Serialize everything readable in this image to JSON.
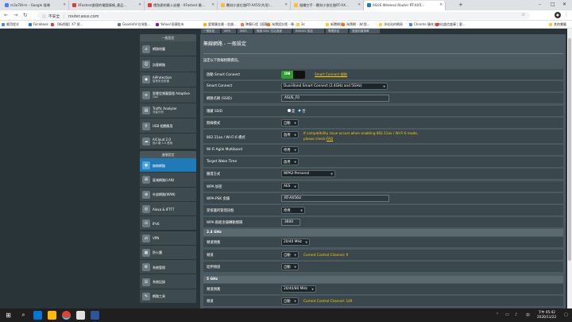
{
  "browser": {
    "tabs": [
      {
        "label": "m3a78l-m - Google 搜尋",
        "color": "#4285f4"
      },
      {
        "label": "XFastest處理的電腦情報_產品...",
        "color": "#e53935"
      },
      {
        "label": "禮急開的最入迫聲 - XFastest 最...",
        "color": "#e53935"
      },
      {
        "label": "覆刻小欲位路RT-AX55(共用)...",
        "color": "#fbc02d"
      },
      {
        "label": "縫纖空手 - 覆刻小欲位路RT-AX...",
        "color": "#fbc02d"
      },
      {
        "label": "ASUS Wireless Router RT-AX5...",
        "color": "#1f7ab8"
      }
    ],
    "new_tab": "+",
    "url": "router.asus.com",
    "security_label": "不安全",
    "window_controls": [
      "–",
      "□",
      "✕"
    ]
  },
  "bookmarks": [
    {
      "label": "應用程式",
      "color": "#4285f4"
    },
    {
      "label": "Facebook",
      "color": "#1877f2"
    },
    {
      "label": "【新遊隆】X7 搜...",
      "color": "#e53935"
    },
    {
      "label": "Goodinfo!台灣股...",
      "color": "#607d8b"
    },
    {
      "label": "Yahoo!奇摩股市",
      "color": "#7b1fa2"
    },
    {
      "label": "愛爾蘭金屬 - 金銀...",
      "color": "#ffb300"
    },
    {
      "label": "準備行程【孤龍...",
      "color": "#ff7043"
    },
    {
      "label": "淘寶設計館 - 尋...",
      "color": "#ff6d00"
    },
    {
      "label": "3c",
      "color": "#ffca28"
    },
    {
      "label": "新聞網頁",
      "color": "#ffca28"
    },
    {
      "label": "淘寶網 - 淘!我...",
      "color": "#ff6d00"
    },
    {
      "label": "淨化站的網頁",
      "color": "#ffca28"
    },
    {
      "label": "Chrome 擴充大集",
      "color": "#4285f4"
    },
    {
      "label": "松盛信盛庫 | 要...",
      "color": "#e53935"
    },
    {
      "label": "其他書籤",
      "color": "#ffca28"
    }
  ],
  "router_top_tabs": [
    "一般設定",
    "WPS",
    "WDS",
    "無線 MAC 位址過濾",
    "RADIUS 設定",
    "專業設定",
    "漫遊封鎖清單"
  ],
  "sidebar": {
    "general_header": "一般設定",
    "general_items": [
      {
        "label": "網路地圖",
        "icon": "network-map-icon",
        "glyph": "⌂"
      },
      {
        "label": "訪客網路",
        "icon": "guest-network-icon",
        "glyph": "☺"
      },
      {
        "label": "AiProtection",
        "sub": "智慧安全防護",
        "icon": "aiprotection-icon",
        "glyph": "◆"
      },
      {
        "label": "智慧型頻寬管理 Adaptive",
        "sub": "QoS",
        "icon": "qos-icon",
        "glyph": "≋"
      },
      {
        "label": "Traffic Analyzer",
        "sub": "流量分析",
        "icon": "traffic-analyzer-icon",
        "glyph": "▤"
      },
      {
        "label": "USB 相關應用",
        "icon": "usb-icon",
        "glyph": "⚲"
      },
      {
        "label": "AiCloud 2.0",
        "sub": "個人雲 2.0 應用",
        "icon": "aicloud-icon",
        "glyph": "☁"
      }
    ],
    "advanced_header": "進階設定",
    "advanced_items": [
      {
        "label": "無線網路",
        "icon": "wireless-icon",
        "glyph": "◉",
        "selected": true
      },
      {
        "label": "區域網路(LAN)",
        "icon": "lan-icon",
        "glyph": "⊞"
      },
      {
        "label": "外部網路(WAN)",
        "icon": "wan-icon",
        "glyph": "⊕"
      },
      {
        "label": "Alexa & IFTTT",
        "icon": "alexa-icon",
        "glyph": "◎"
      },
      {
        "label": "IPv6",
        "icon": "ipv6-icon",
        "glyph": "⊙"
      },
      {
        "label": "VPN",
        "icon": "vpn-icon",
        "glyph": "⇄"
      },
      {
        "label": "防火牆",
        "icon": "firewall-icon",
        "glyph": "▦"
      },
      {
        "label": "系統管理",
        "icon": "admin-icon",
        "glyph": "⚙"
      },
      {
        "label": "系統記錄",
        "icon": "syslog-icon",
        "glyph": "☰"
      },
      {
        "label": "網路工具",
        "icon": "network-tools-icon",
        "glyph": "✎"
      }
    ]
  },
  "content": {
    "title": "無線網路 - 一般設定",
    "subtitle": "設定以下無線相關資訊。",
    "rows": [
      {
        "label": "啟動 Smart Connect",
        "type": "toggle",
        "value": "ON",
        "link": "Smart Connect 規則"
      },
      {
        "label": "Smart Connect",
        "type": "select",
        "value": "Dual-Band Smart Connect (2.4GHz and 5GHz)"
      },
      {
        "label": "網路名稱 (SSID)",
        "type": "input",
        "value": "ASUS_F0"
      },
      {
        "label": "隱藏 SSID",
        "type": "radio",
        "options": [
          "是",
          "否"
        ],
        "selected": 1
      },
      {
        "label": "無線模式",
        "type": "select",
        "value": "自動"
      },
      {
        "label": "802.11ax / Wi-Fi 6 模式",
        "type": "select",
        "value": "啟用",
        "note1": "If compatibility issue occurs when enabling 802.11ax / Wi-Fi 6 mode,",
        "note2": "please check:",
        "note_link": "FAQ"
      },
      {
        "label": "Wi-Fi Agile Multiband",
        "type": "select",
        "value": "停用"
      },
      {
        "label": "Target Wake Time",
        "type": "select",
        "value": "啟用"
      },
      {
        "label": "驗證方式",
        "type": "select",
        "value": "WPA2-Personal"
      },
      {
        "label": "WPA 加密",
        "type": "select",
        "value": "AES"
      },
      {
        "label": "WPA-PSK 金鑰",
        "type": "input",
        "value": "RT-AX56U"
      },
      {
        "label": "受保護的管理訊框",
        "type": "select",
        "value": "停用"
      },
      {
        "label": "WPA 群組金鑰轉動間隔",
        "type": "input",
        "value": "3600"
      }
    ],
    "band24": {
      "header": "2.4 GHz",
      "rows": [
        {
          "label": "頻道頻寬",
          "value": "20/40 MHz"
        },
        {
          "label": "頻道",
          "value": "自動",
          "note": "Current Control Channel: 9"
        },
        {
          "label": "延伸頻道",
          "value": "自動"
        }
      ]
    },
    "band5": {
      "header": "5 GHz",
      "rows": [
        {
          "label": "頻道頻寬",
          "value": "20/40/80 MHz"
        },
        {
          "label": "頻道",
          "value": "自動",
          "note": "Current Control Channel: 149"
        },
        {
          "label": "延伸頻道",
          "value": "自動"
        }
      ]
    }
  },
  "taskbar": {
    "time": "下午 05:42",
    "date": "2020/11/22",
    "tray_text": "中"
  }
}
